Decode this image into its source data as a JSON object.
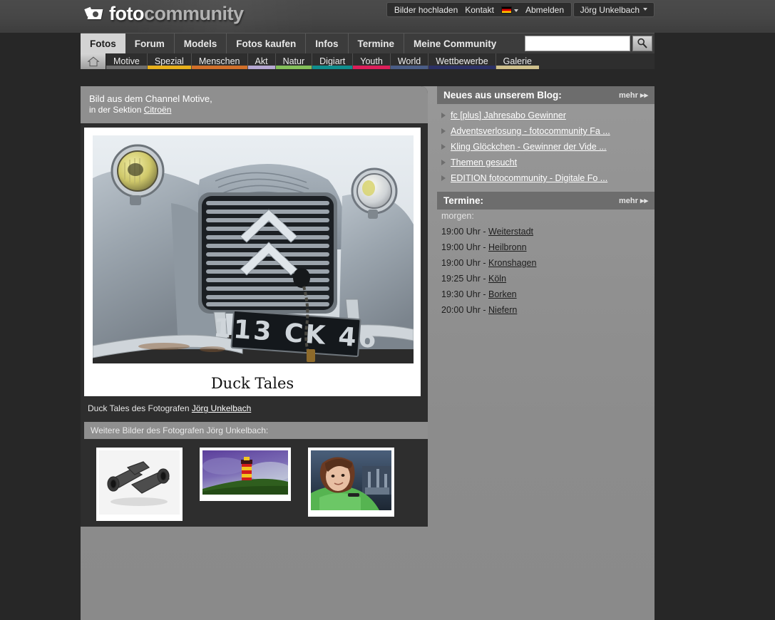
{
  "site": {
    "logo_primary": "foto",
    "logo_secondary": "community",
    "logo_icon": "camera-icon"
  },
  "topbar": {
    "upload": "Bilder hochladen",
    "contact": "Kontakt",
    "language_icon": "german-flag-icon",
    "logout": "Abmelden",
    "user": "Jörg Unkelbach"
  },
  "mainnav": {
    "tabs": [
      {
        "label": "Fotos",
        "active": true
      },
      {
        "label": "Forum",
        "active": false
      },
      {
        "label": "Models",
        "active": false
      },
      {
        "label": "Fotos kaufen",
        "active": false
      },
      {
        "label": "Infos",
        "active": false
      },
      {
        "label": "Termine",
        "active": false
      },
      {
        "label": "Meine Community",
        "active": false
      }
    ]
  },
  "search": {
    "value": "",
    "placeholder": "",
    "icon": "magnifier-icon"
  },
  "subnav": {
    "home_icon": "home-icon",
    "items": [
      {
        "label": "Motive",
        "color": "#6e6e6e"
      },
      {
        "label": "Spezial",
        "color": "#e8b01c"
      },
      {
        "label": "Menschen",
        "color": "#d2702a"
      },
      {
        "label": "Akt",
        "color": "#b6a8d2"
      },
      {
        "label": "Natur",
        "color": "#84c05a"
      },
      {
        "label": "Digiart",
        "color": "#0f8e8e"
      },
      {
        "label": "Youth",
        "color": "#dd1f5a"
      },
      {
        "label": "World",
        "color": "#4a5d86"
      },
      {
        "label": "Wettbewerbe",
        "color": "#2c3166"
      },
      {
        "label": "Galerie",
        "color": "#cfc08c"
      }
    ]
  },
  "channel": {
    "line1": "Bild aus dem Channel Motive,",
    "line2_prefix": "in der Sektion ",
    "section_link": "Citroën"
  },
  "photo": {
    "title": "Duck Tales",
    "license_plate": "113 CK 46",
    "credit_prefix": "Duck Tales des Fotografen ",
    "credit_author": "Jörg Unkelbach",
    "alt": "Front grille of a vintage grey Citroen 2CV with round headlights"
  },
  "more_images": {
    "header": "Weitere Bilder des Fotografen Jörg Unkelbach:",
    "thumbs": [
      {
        "name": "metal-pipe-fitting-thumb"
      },
      {
        "name": "lighthouse-thumb"
      },
      {
        "name": "portrait-woman-thumb"
      }
    ]
  },
  "blog": {
    "title": "Neues aus unserem Blog:",
    "more_label": "mehr",
    "items": [
      "fc [plus] Jahresabo Gewinner",
      "Adventsverlosung - fotocommunity Fa ...",
      "Kling Glöckchen - Gewinner der Vide ...",
      "Themen gesucht",
      "EDITION fotocommunity - Digitale Fo ..."
    ]
  },
  "termine": {
    "title": "Termine:",
    "more_label": "mehr",
    "when": "morgen:",
    "entries": [
      {
        "time": "19:00 Uhr - ",
        "place": "Weiterstadt"
      },
      {
        "time": "19:00 Uhr - ",
        "place": "Heilbronn"
      },
      {
        "time": "19:00 Uhr - ",
        "place": "Kronshagen"
      },
      {
        "time": "19:25 Uhr - ",
        "place": "Köln"
      },
      {
        "time": "19:30 Uhr - ",
        "place": "Borken"
      },
      {
        "time": "20:00 Uhr - ",
        "place": "Niefern"
      }
    ]
  },
  "colors": {
    "panel": "#8f8f8f",
    "dark": "#2e2e2e",
    "accent_active": "#d3d3d3"
  }
}
